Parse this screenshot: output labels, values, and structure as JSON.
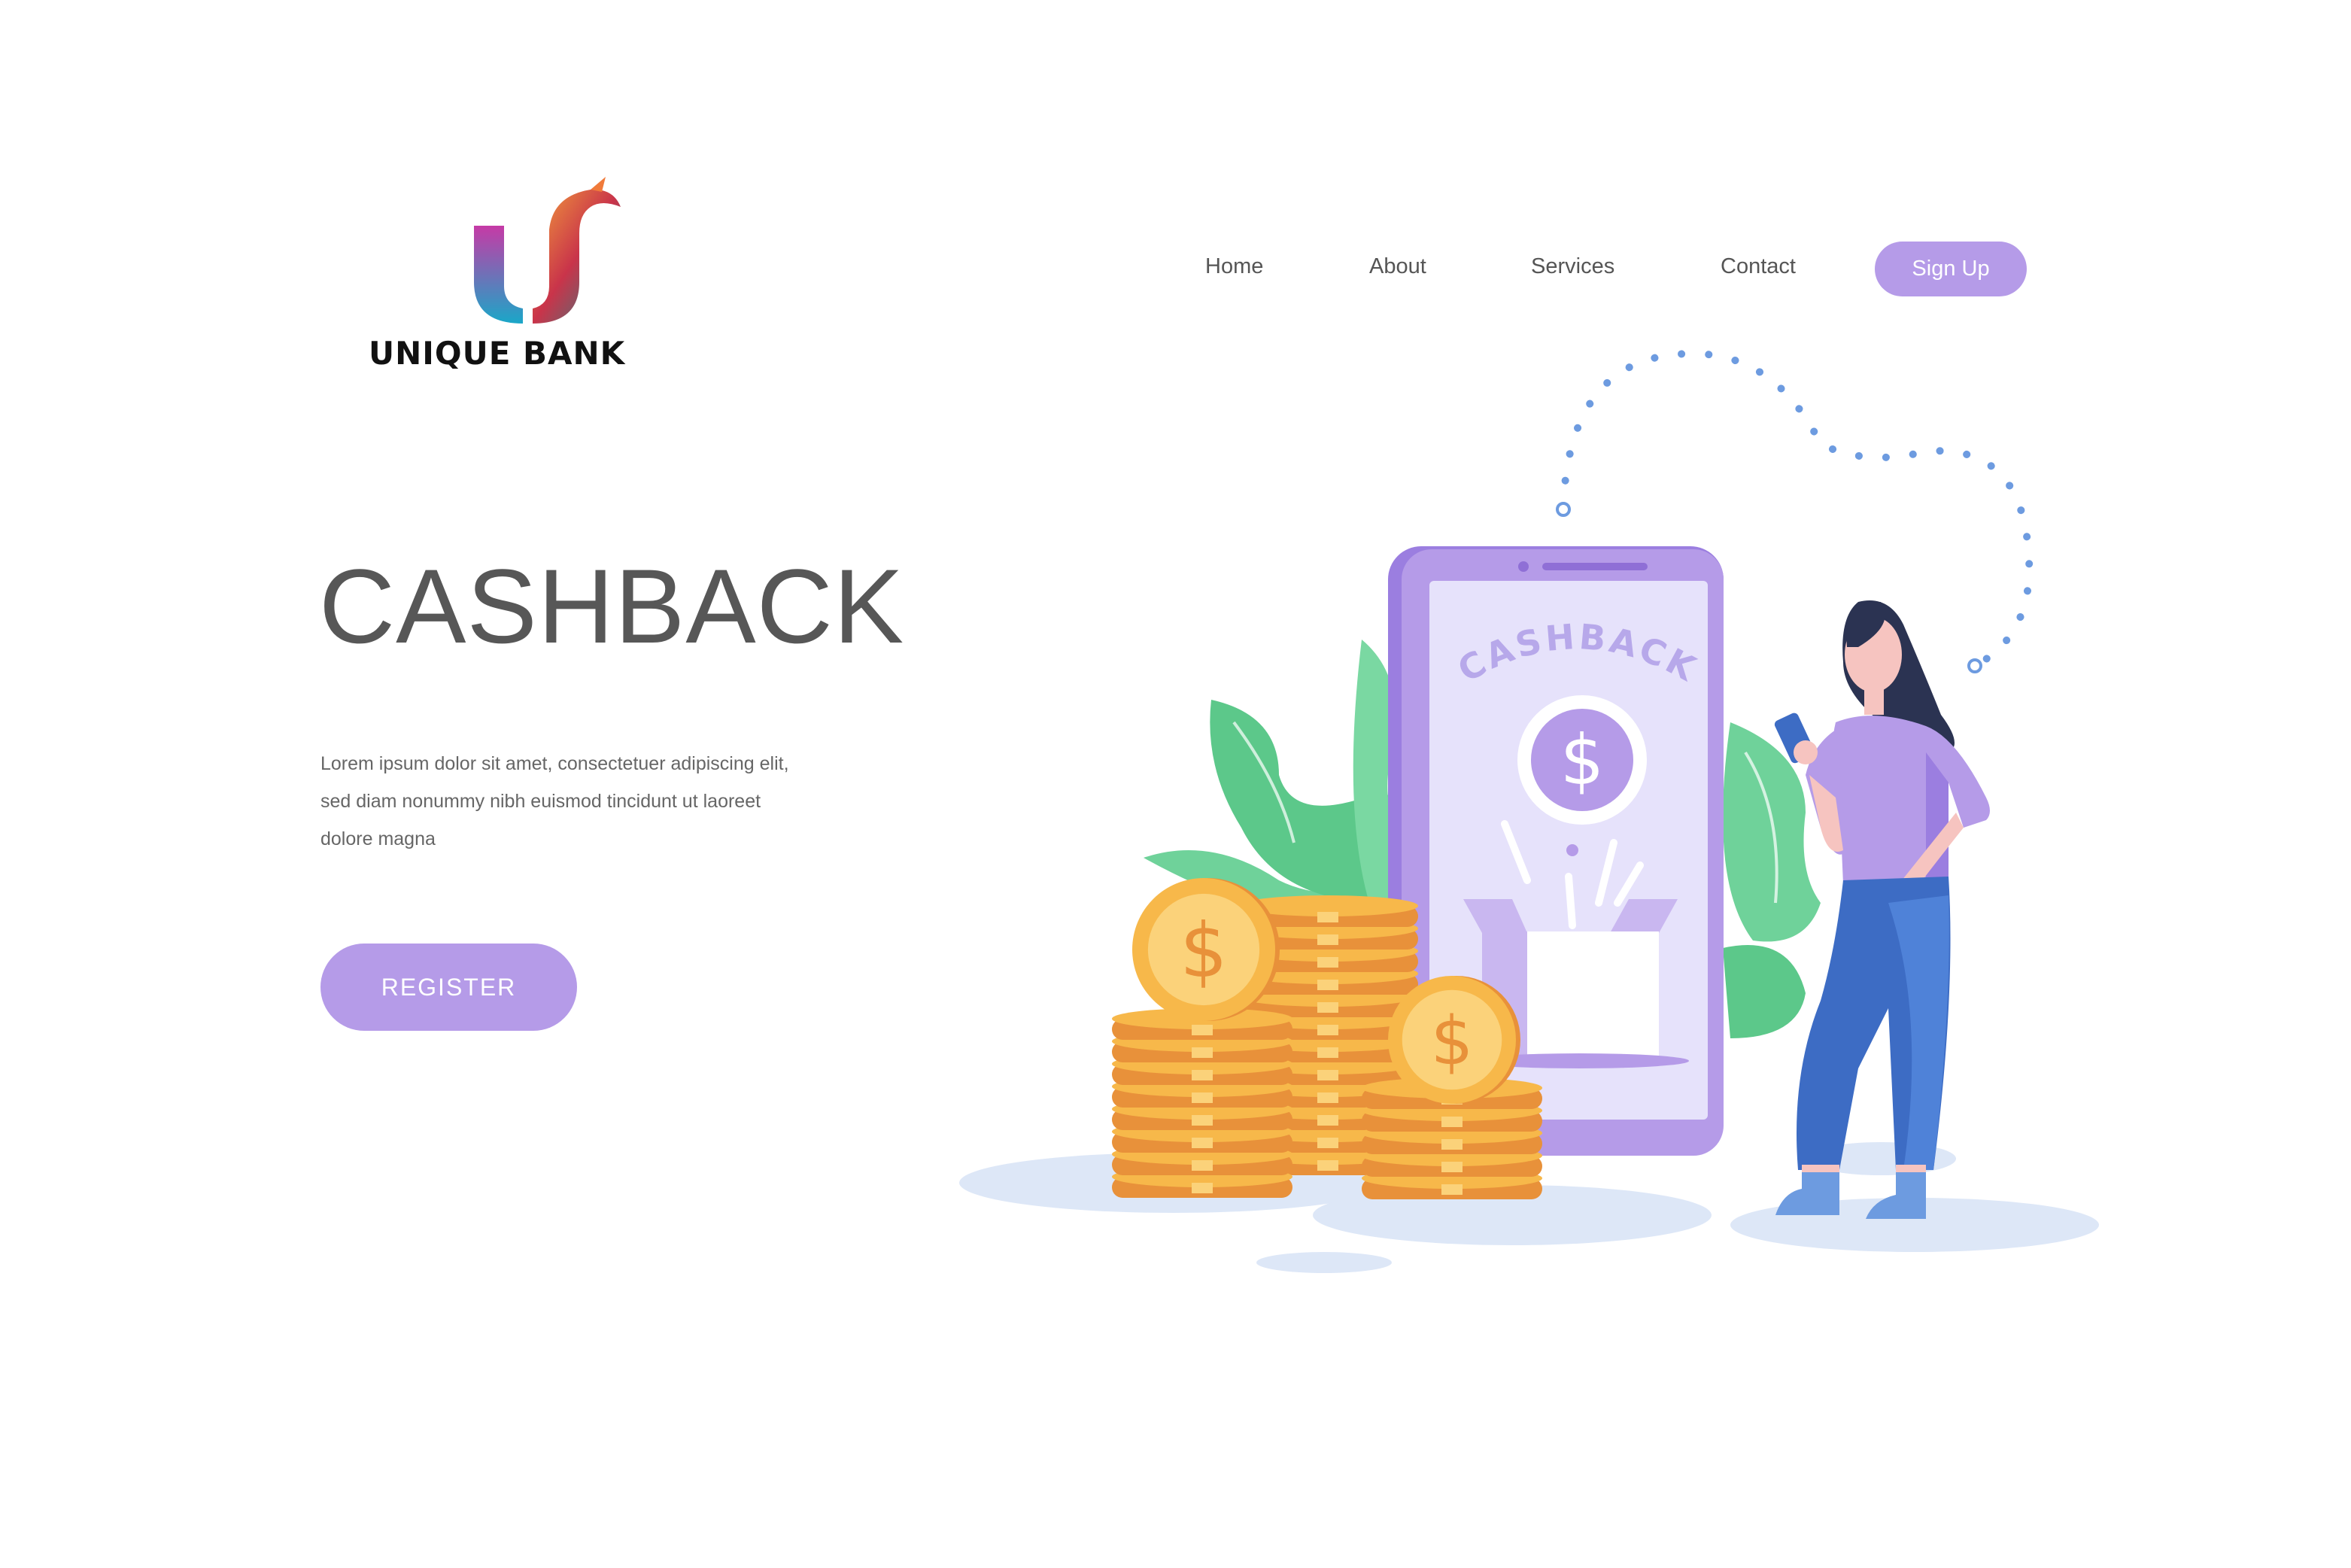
{
  "brand": {
    "name": "UNIQUE BANK",
    "logo_icon": "u-bird-logo-icon"
  },
  "nav": {
    "items": [
      {
        "label": "Home"
      },
      {
        "label": "About"
      },
      {
        "label": "Services"
      },
      {
        "label": "Contact"
      }
    ],
    "signup_label": "Sign Up"
  },
  "hero": {
    "title": "CASHBACK",
    "description_lines": [
      "Lorem ipsum dolor sit amet, consectetuer adipiscing elit,",
      "sed diam nonummy nibh euismod tincidunt ut laoreet",
      "dolore magna"
    ],
    "register_label": "REGISTER"
  },
  "illustration": {
    "phone_label": "CASHBACK",
    "coin_symbol": "$",
    "icons": [
      "smartphone-icon",
      "coin-stack-icon",
      "dollar-coin-icon",
      "gift-box-icon",
      "leaf-icon",
      "woman-figure",
      "dotted-path"
    ]
  },
  "colors": {
    "accent": "#b59be8",
    "phone_frame": "#9b7ee0",
    "phone_screen": "#e6e2fb",
    "coin": "#f7b84a",
    "coin_dark": "#e8913a",
    "leaf": "#6fd29a",
    "jeans": "#3d6cc4",
    "path_dots": "#6d9be0",
    "shadow": "#dde7f7"
  }
}
